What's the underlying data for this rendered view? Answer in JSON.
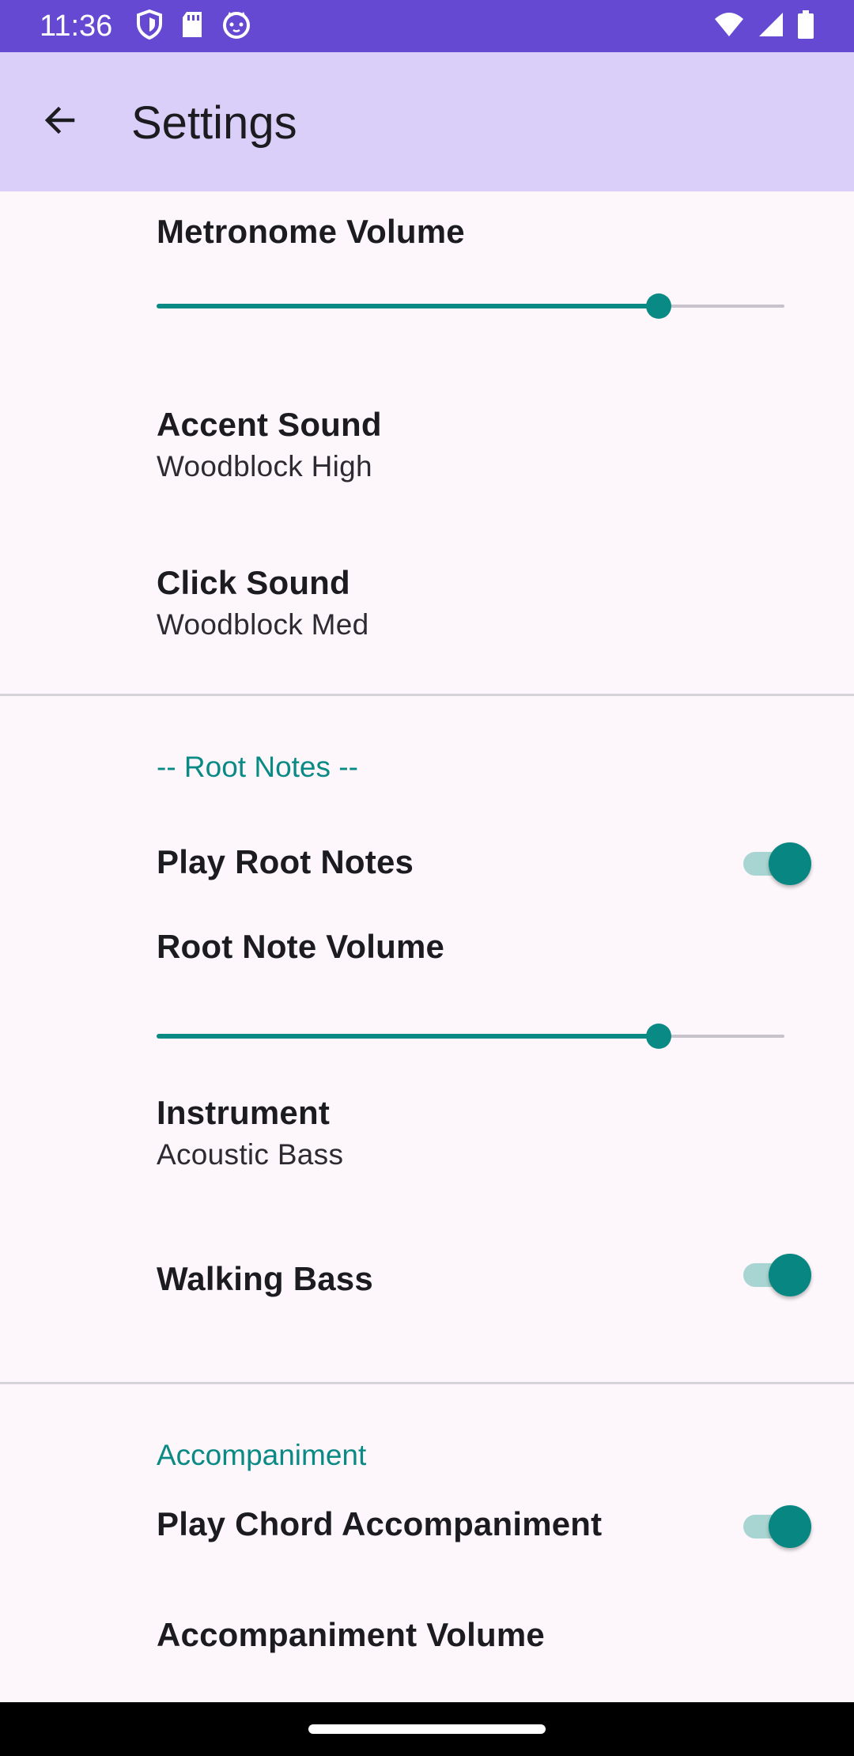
{
  "status_bar": {
    "time": "11:36",
    "left_icons": [
      "shield-icon",
      "sd-card-icon",
      "cat-face-icon"
    ],
    "right_icons": [
      "wifi-icon",
      "cell-signal-icon",
      "battery-icon"
    ]
  },
  "app_bar": {
    "title": "Settings",
    "back_icon": "arrow-back-icon"
  },
  "sections": {
    "metronome": {
      "volume": {
        "title": "Metronome Volume",
        "value_fraction": 0.8
      },
      "accent": {
        "title": "Accent Sound",
        "summary": "Woodblock High"
      },
      "click": {
        "title": "Click Sound",
        "summary": "Woodblock Med"
      }
    },
    "root_notes": {
      "category": "-- Root Notes --",
      "play": {
        "title": "Play Root Notes",
        "checked": true
      },
      "volume": {
        "title": "Root Note Volume",
        "value_fraction": 0.8
      },
      "instrument": {
        "title": "Instrument",
        "summary": "Acoustic Bass"
      },
      "walking_bass": {
        "title": "Walking Bass",
        "checked": true
      }
    },
    "accompaniment": {
      "category": "Accompaniment",
      "play": {
        "title": "Play Chord Accompaniment",
        "checked": true
      },
      "volume": {
        "title": "Accompaniment Volume"
      }
    }
  },
  "colors": {
    "status_bar": "#6549d3",
    "app_bar": "#dacff8",
    "background": "#fdf7fc",
    "accent": "#0a8a85",
    "switch_track": "#a8d4d2"
  }
}
